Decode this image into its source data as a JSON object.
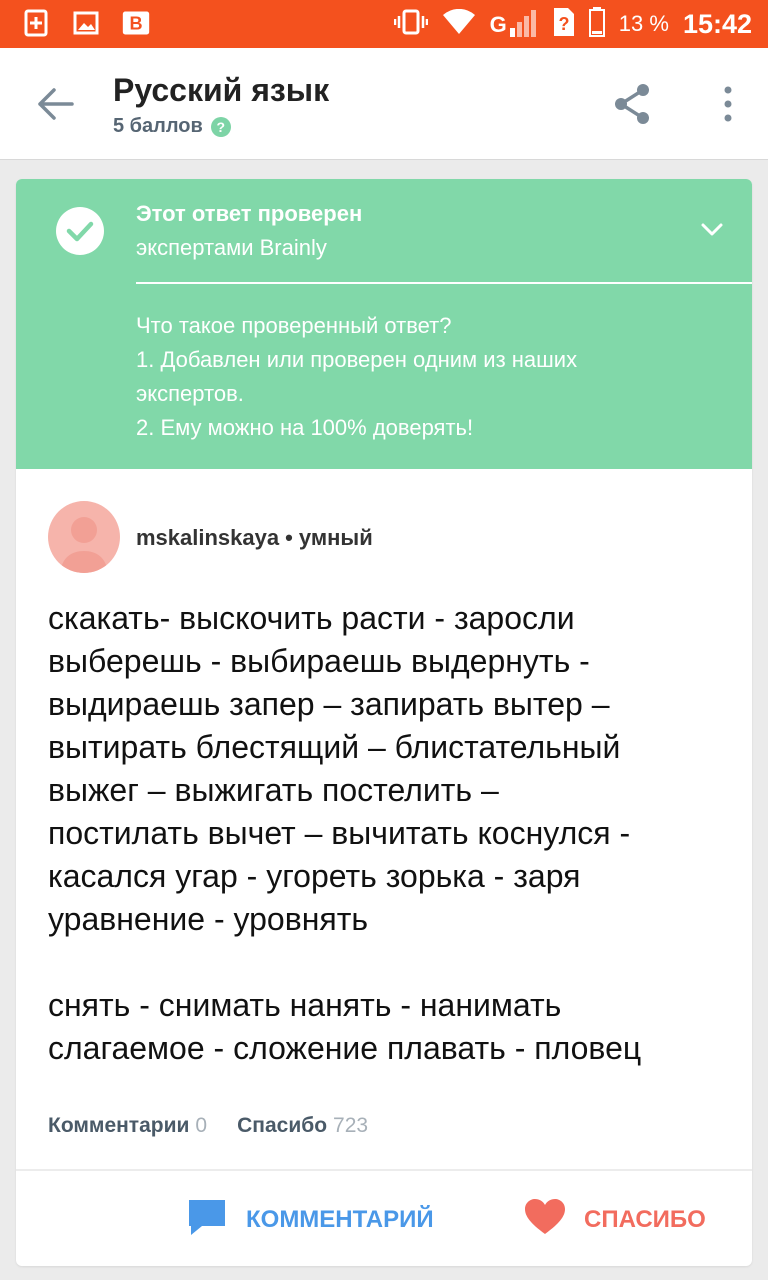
{
  "status_bar": {
    "battery_percent": "13 %",
    "time": "15:42",
    "network": "G"
  },
  "header": {
    "title": "Русский язык",
    "points": "5 баллов",
    "help": "?"
  },
  "verified": {
    "title": "Этот ответ проверен",
    "subtitle": "экспертами Brainly",
    "info": [
      "Что такое проверенный ответ?",
      "1. Добавлен или проверен одним из наших",
      "экспертов.",
      "2. Ему можно на 100% доверять!"
    ]
  },
  "author": {
    "name": "mskalinskaya",
    "rank": "• умный"
  },
  "answer": {
    "lines": [
      "скакать- выскочить расти - заросли",
      "выберешь - выбираешь выдернуть -",
      "выдираешь запер – запирать вытер –",
      "вытирать блестящий – блистательный",
      "выжег – выжигать постелить –",
      "постилать вычет – вычитать коснулся -",
      "касался угар - угореть зорька - заря",
      "уравнение - уровнять"
    ],
    "lines2": [
      "снять - снимать нанять - нанимать",
      "слагаемое - сложение плавать - пловец"
    ]
  },
  "stats": {
    "comments_label": "Комментарии",
    "comments_count": "0",
    "thanks_label": "Спасибо",
    "thanks_count": "723"
  },
  "actions": {
    "comment_label": "КОММЕНТАРИЙ",
    "thanks_label": "СПАСИБО"
  },
  "colors": {
    "status_bar": "#f4511e",
    "verified_bg": "#81d8a9",
    "comment_blue": "#4a98e8",
    "thanks_red": "#f26c5e"
  }
}
